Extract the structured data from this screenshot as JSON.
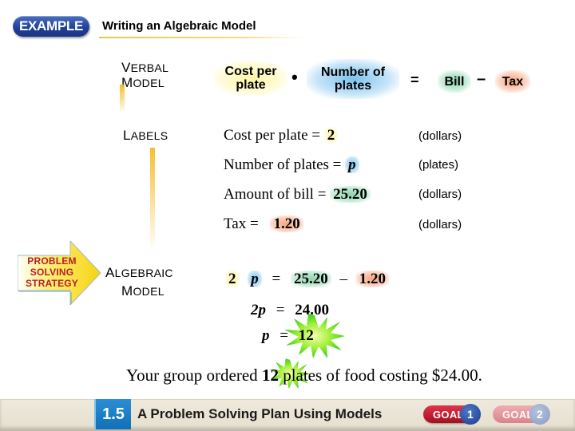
{
  "header": {
    "badge_label": "EXAMPLE",
    "title": "Writing an Algebraic Model"
  },
  "verbal_model": {
    "label_first": "V",
    "label_rest": "ERBAL",
    "label2_first": "M",
    "label2_rest": "ODEL",
    "cost_per_plate": "Cost per plate",
    "times_symbol": "•",
    "number_of_plates": "Number of plates",
    "equals": "=",
    "bill": "Bill",
    "minus": "–",
    "tax": "Tax"
  },
  "labels": {
    "label_first": "L",
    "label_rest": "ABELS",
    "rows": [
      {
        "text": "Cost per plate  =",
        "value": "2",
        "unit": "(dollars)",
        "color": "#fff3a0"
      },
      {
        "text": "Number of plates  =",
        "value": "p",
        "unit": "(plates)",
        "color": "#7cc2ef"
      },
      {
        "text": "Amount of bill  =",
        "value": "25.20",
        "unit": "(dollars)",
        "color": "#8fd3ad"
      },
      {
        "text": "Tax =",
        "value": "1.20",
        "unit": "(dollars)",
        "color": "#f7a27e"
      }
    ]
  },
  "strategy": {
    "line1": "PROBLEM",
    "line2": "SOLVING",
    "line3": "STRATEGY"
  },
  "algebraic_model": {
    "label_first": "A",
    "label_rest": "LGEBRAIC",
    "label2_first": "M",
    "label2_rest": "ODEL",
    "line1": {
      "a": "2",
      "b": "p",
      "eq": "=",
      "c": "25.20",
      "op": "–",
      "d": "1.20"
    },
    "line2": {
      "lhs": "2p",
      "eq": "=",
      "rhs": "24.00"
    },
    "line3": {
      "lhs": "p",
      "eq": "=",
      "rhs": "12"
    }
  },
  "conclusion": {
    "before": "Your group ordered ",
    "highlight": "12",
    "after": " plates of food costing $24.00."
  },
  "footer": {
    "lesson_number": "1.5",
    "lesson_title": "A Problem Solving Plan Using Models",
    "goal1_label": "GOAL",
    "goal1_num": "1",
    "goal2_label": "GOAL",
    "goal2_num": "2"
  }
}
